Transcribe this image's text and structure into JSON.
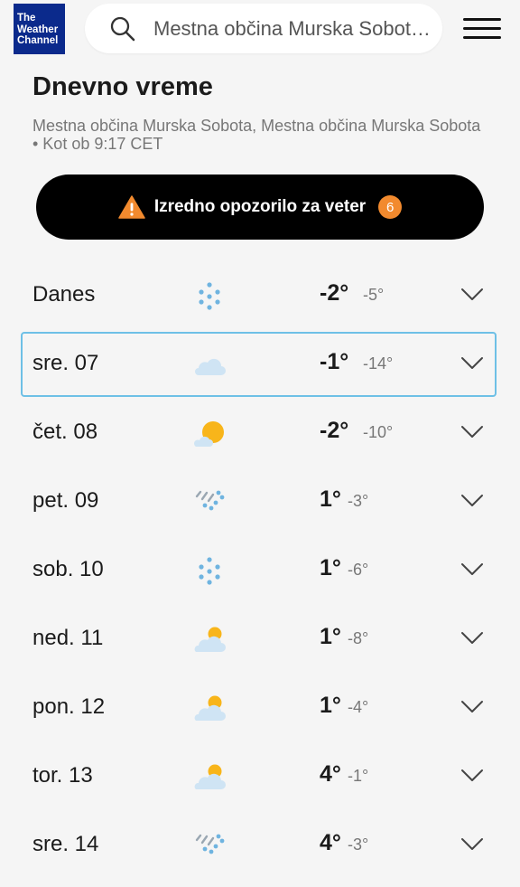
{
  "header": {
    "logo_lines": [
      "The",
      "Weather",
      "Channel"
    ],
    "search_query": "Mestna občina Murska Sobot…"
  },
  "page_title": "Dnevno vreme",
  "subtitle": "Mestna občina Murska Sobota, Mestna občina Murska Sobota • Kot ob 9:17 CET",
  "alert": {
    "label": "Izredno opozorilo za veter",
    "count": "6"
  },
  "days": [
    {
      "day": "Danes",
      "icon": "snow-icon",
      "hi": "-2°",
      "lo": "-5°"
    },
    {
      "day": "sre. 07",
      "icon": "cloud-icon",
      "hi": "-1°",
      "lo": "-14°"
    },
    {
      "day": "čet. 08",
      "icon": "mostly-sunny-icon",
      "hi": "-2°",
      "lo": "-10°"
    },
    {
      "day": "pet. 09",
      "icon": "wintry-mix-icon",
      "hi": "1°",
      "lo": "-3°"
    },
    {
      "day": "sob. 10",
      "icon": "snow-icon",
      "hi": "1°",
      "lo": "-6°"
    },
    {
      "day": "ned. 11",
      "icon": "partly-cloudy-icon",
      "hi": "1°",
      "lo": "-8°"
    },
    {
      "day": "pon. 12",
      "icon": "partly-cloudy-icon",
      "hi": "1°",
      "lo": "-4°"
    },
    {
      "day": "tor. 13",
      "icon": "partly-cloudy-icon",
      "hi": "4°",
      "lo": "-1°"
    },
    {
      "day": "sre. 14",
      "icon": "wintry-mix-icon",
      "hi": "4°",
      "lo": "-3°"
    }
  ],
  "selected_index": 1,
  "colors": {
    "brand": "#0b2a8c",
    "alert_badge": "#f28a2e",
    "selected_border": "#6ec0e6"
  }
}
